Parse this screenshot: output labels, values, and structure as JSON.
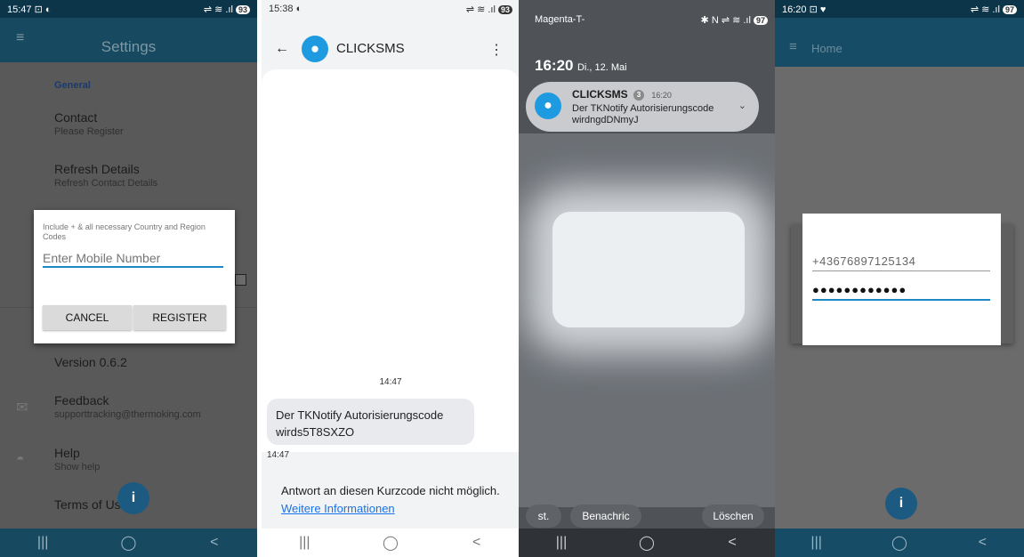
{
  "panel1": {
    "status": {
      "time": "15:47",
      "left_icons": "⊡ ◐",
      "right_icons": "⇌ ≋ .ıl",
      "battery": "93"
    },
    "appbar_title": "Settings",
    "section_general": "General",
    "items": [
      {
        "main": "Contact",
        "sub": "Please Register"
      },
      {
        "main": "Refresh Details",
        "sub": "Refresh Contact Details"
      },
      {
        "main": "Version 0.6.2",
        "sub": ""
      },
      {
        "main": "Feedback",
        "sub": "supporttracking@thermoking.com"
      },
      {
        "main": "Help",
        "sub": "Show help"
      },
      {
        "main": "Terms of Use",
        "sub": ""
      }
    ],
    "dialog": {
      "hint": "Include + & all necessary Country and Region Codes",
      "placeholder": "Enter Mobile Number",
      "cancel": "CANCEL",
      "register": "REGISTER"
    },
    "nav": [
      "|||",
      "◯",
      "<"
    ]
  },
  "panel2": {
    "status": {
      "time": "15:38",
      "left_icons": "◐",
      "right_icons": "⇌ ≋ .ıl",
      "battery": "93"
    },
    "contact_name": "CLICKSMS",
    "timestamp_top": "14:47",
    "message": "Der TKNotify Autorisierungscode wirds5T8SXZO",
    "timestamp_bottom": "14:47",
    "notice_text": "Antwort an diesen Kurzcode nicht möglich.",
    "notice_link": "Weitere Informationen",
    "nav": [
      "|||",
      "◯",
      "<"
    ]
  },
  "panel3": {
    "status": {
      "carrier": "Magenta-T-",
      "right_icons": "✱ N ⇌ ≋ .ıl",
      "battery": "97"
    },
    "clock_time": "16:20",
    "clock_date": "Di., 12. Mai",
    "notification": {
      "app": "CLICKSMS",
      "count": "3",
      "time": "16:20",
      "message": "Der TKNotify Autorisierungscode wirdngdDNmyJ"
    },
    "actions": {
      "left": "st.",
      "middle": "Benachric",
      "right": "Löschen"
    },
    "nav": [
      "|||",
      "◯",
      "<"
    ]
  },
  "panel4": {
    "status": {
      "time": "16:20",
      "left_icons": "⊡ ♥",
      "right_icons": "⇌ ≋ .ıl",
      "battery": "97"
    },
    "appbar_title": "Home",
    "phone_value": "+43676897125134",
    "password_value": "●●●●●●●●●●●●",
    "nav": [
      "|||",
      "◯",
      "<"
    ]
  }
}
